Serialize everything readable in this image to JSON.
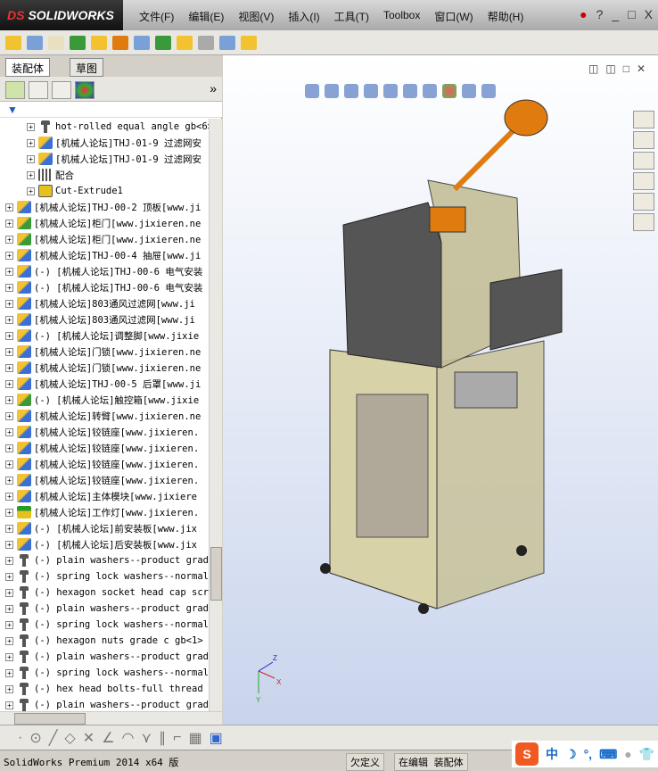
{
  "app": {
    "logo": "SOLIDWORKS",
    "logo_prefix": "DS"
  },
  "menu": [
    "文件(F)",
    "编辑(E)",
    "视图(V)",
    "插入(I)",
    "工具(T)",
    "Toolbox",
    "窗口(W)",
    "帮助(H)"
  ],
  "window_controls": [
    "?",
    "_",
    "□",
    "X"
  ],
  "left_panel": {
    "tabs": [
      "装配体",
      "草图"
    ],
    "active_tab": "装配体",
    "filter_icon": "filter-icon",
    "tree": [
      {
        "indent": 2,
        "icon": "part",
        "label": "hot-rolled equal angle gb<6>"
      },
      {
        "indent": 2,
        "icon": "asm",
        "label": "[机械人论坛]THJ-01-9 过滤网安"
      },
      {
        "indent": 2,
        "icon": "asm",
        "label": "[机械人论坛]THJ-01-9 过滤网安"
      },
      {
        "indent": 2,
        "icon": "mate",
        "label": "配合"
      },
      {
        "indent": 2,
        "icon": "feat",
        "label": "Cut-Extrude1"
      },
      {
        "indent": 0,
        "icon": "asm",
        "label": "[机械人论坛]THJ-00-2 顶板[www.ji"
      },
      {
        "indent": 0,
        "icon": "asmg",
        "label": "[机械人论坛]柜门[www.jixieren.ne"
      },
      {
        "indent": 0,
        "icon": "asmg",
        "label": "[机械人论坛]柜门[www.jixieren.ne"
      },
      {
        "indent": 0,
        "icon": "asm",
        "label": "[机械人论坛]THJ-00-4 抽屉[www.ji"
      },
      {
        "indent": 0,
        "icon": "asm",
        "label": "(-) [机械人论坛]THJ-00-6 电气安装"
      },
      {
        "indent": 0,
        "icon": "asm",
        "label": "(-) [机械人论坛]THJ-00-6 电气安装"
      },
      {
        "indent": 0,
        "icon": "asm",
        "label": "[机械人论坛]803通风过滤网[www.ji"
      },
      {
        "indent": 0,
        "icon": "asm",
        "label": "[机械人论坛]803通风过滤网[www.ji"
      },
      {
        "indent": 0,
        "icon": "asm",
        "label": "(-) [机械人论坛]调整脚[www.jixie"
      },
      {
        "indent": 0,
        "icon": "asm",
        "label": "[机械人论坛]门锁[www.jixieren.ne"
      },
      {
        "indent": 0,
        "icon": "asm",
        "label": "[机械人论坛]门锁[www.jixieren.ne"
      },
      {
        "indent": 0,
        "icon": "asm",
        "label": "[机械人论坛]THJ-00-5 后罩[www.ji"
      },
      {
        "indent": 0,
        "icon": "asmg",
        "label": "(-) [机械人论坛]触控箱[www.jixie"
      },
      {
        "indent": 0,
        "icon": "asm",
        "label": "[机械人论坛]转臂[www.jixieren.ne"
      },
      {
        "indent": 0,
        "icon": "asm",
        "label": "[机械人论坛]铰链座[www.jixieren."
      },
      {
        "indent": 0,
        "icon": "asm",
        "label": "[机械人论坛]铰链座[www.jixieren."
      },
      {
        "indent": 0,
        "icon": "asm",
        "label": "[机械人论坛]铰链座[www.jixieren."
      },
      {
        "indent": 0,
        "icon": "asm",
        "label": "[机械人论坛]铰链座[www.jixieren."
      },
      {
        "indent": 0,
        "icon": "asm",
        "label": "[机械人论坛]主体模块[www.jixiere"
      },
      {
        "indent": 0,
        "icon": "light",
        "label": "[机械人论坛]工作灯[www.jixieren."
      },
      {
        "indent": 0,
        "icon": "asm",
        "label": "(-) [机械人论坛]前安装板[www.jix"
      },
      {
        "indent": 0,
        "icon": "asm",
        "label": "(-) [机械人论坛]后安装板[www.jix"
      },
      {
        "indent": 0,
        "icon": "part",
        "label": "(-) plain washers--product grade"
      },
      {
        "indent": 0,
        "icon": "part",
        "label": "(-) spring lock washers--normal"
      },
      {
        "indent": 0,
        "icon": "part",
        "label": "(-) hexagon socket head cap scre"
      },
      {
        "indent": 0,
        "icon": "part",
        "label": "(-) plain washers--product grade"
      },
      {
        "indent": 0,
        "icon": "part",
        "label": "(-) spring lock washers--normal"
      },
      {
        "indent": 0,
        "icon": "part",
        "label": "(-) hexagon nuts grade c gb<1>"
      },
      {
        "indent": 0,
        "icon": "part",
        "label": "(-) plain washers--product grade"
      },
      {
        "indent": 0,
        "icon": "part",
        "label": "(-) spring lock washers--normal"
      },
      {
        "indent": 0,
        "icon": "part",
        "label": "(-) hex head bolts-full thread g"
      },
      {
        "indent": 0,
        "icon": "part",
        "label": "(-) plain washers--product grade"
      }
    ]
  },
  "viewport": {
    "triad": {
      "x": "X",
      "y": "Y",
      "z": "Z"
    }
  },
  "status": {
    "product": "SolidWorks Premium 2014 x64 版",
    "state": "欠定义",
    "mode": "在编辑 装配体"
  },
  "ime": {
    "logo": "S",
    "lang": "中"
  }
}
